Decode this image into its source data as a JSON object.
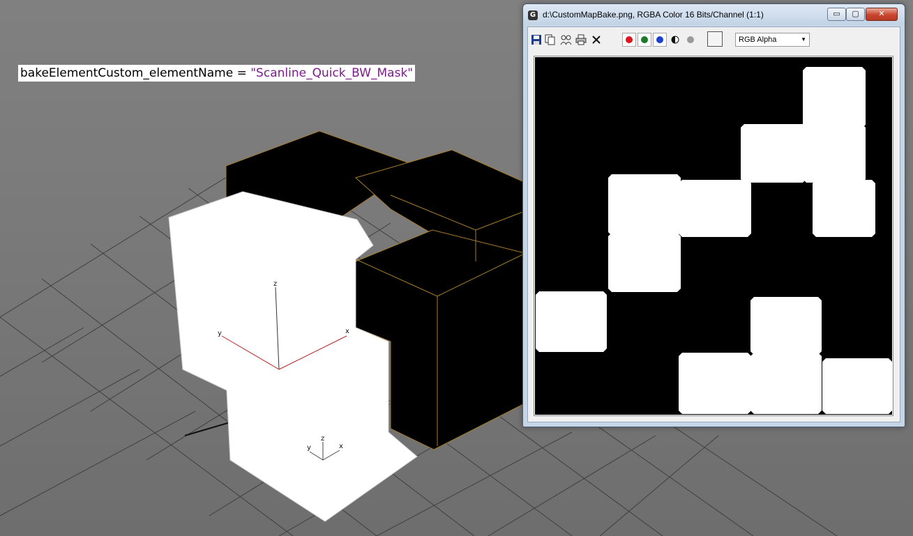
{
  "viewport": {
    "code_var": "bakeElementCustom_elementName",
    "code_op": " = ",
    "code_value": "\"Scanline_Quick_BW_Mask\"",
    "gizmo_main": {
      "z": "z",
      "y": "y",
      "x": "x"
    },
    "gizmo_pivot": {
      "z": "z",
      "y": "y",
      "x": "x"
    }
  },
  "image_window": {
    "title": "d:\\CustomMapBake.png, RGBA Color 16 Bits/Channel (1:1)",
    "controls": {
      "minimize": "▭",
      "maximize": "▢",
      "close": "✕"
    },
    "toolbar": {
      "save_icon": "save-icon",
      "copy_icon": "copy-icon",
      "clone_icon": "clone-icon",
      "print_icon": "print-icon",
      "clear_icon": "clear-icon",
      "channels": [
        {
          "name": "red",
          "color": "#e0141e"
        },
        {
          "name": "green",
          "color": "#1a7a28"
        },
        {
          "name": "blue",
          "color": "#1b3fd0"
        }
      ],
      "channel_display": {
        "selected": "RGB Alpha"
      }
    }
  }
}
